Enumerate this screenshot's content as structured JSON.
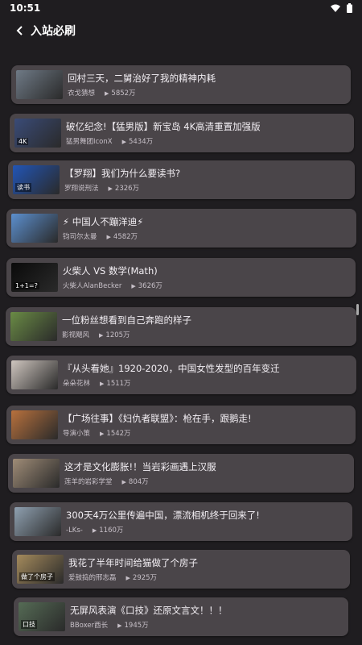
{
  "status": {
    "time": "10:51"
  },
  "header": {
    "title": "入站必刷"
  },
  "videos": [
    {
      "title": "回村三天，二舅治好了我的精神内耗",
      "author": "衣戈猜想",
      "views": "5852万",
      "thumb_color": "#6f7a86"
    },
    {
      "title": "破亿纪念!【猛男版】新宝岛 4K高清重置加强版",
      "author": "猛男舞团IconX",
      "views": "5434万",
      "thumb_color": "#3a4b77",
      "badge": "4K"
    },
    {
      "title": "【罗翔】我们为什么要读书?",
      "author": "罗翔说刑法",
      "views": "2326万",
      "thumb_color": "#2255b5",
      "badge": "读书"
    },
    {
      "title": "⚡ 中国人不蹦洋迪⚡",
      "author": "钧司尔太曼",
      "views": "4582万",
      "thumb_color": "#5c8fce"
    },
    {
      "title": "火柴人 VS 数学(Math)",
      "author": "火柴人AlanBecker",
      "views": "3626万",
      "thumb_color": "#0a0a0a",
      "badge": "1+1=?"
    },
    {
      "title": "一位粉丝想看到自己奔跑的样子",
      "author": "影视飓风",
      "views": "1205万",
      "thumb_color": "#6a8b45"
    },
    {
      "title": "『从头看她』1920-2020，中国女性发型的百年变迁",
      "author": "朵朵花林",
      "views": "1511万",
      "thumb_color": "#cfc6bf"
    },
    {
      "title": "【广场往事】《妇仇者联盟》：枪在手，跟鹅走!",
      "author": "导演小策",
      "views": "1542万",
      "thumb_color": "#b8713d"
    },
    {
      "title": "这才是文化膨胀!！当岩彩画遇上汉服",
      "author": "莲羊的岩彩学堂",
      "views": "804万",
      "thumb_color": "#9f8c77"
    },
    {
      "title": "300天4万公里传遍中国，漂流相机终于回来了!",
      "author": "-LKs-",
      "views": "1160万",
      "thumb_color": "#8fa0b0"
    },
    {
      "title": "我花了半年时间给猫做了个房子",
      "author": "爱鼓捣的邢志磊",
      "views": "2925万",
      "thumb_color": "#a48a5c",
      "badge": "做了个房子"
    },
    {
      "title": "无屏风表演《口技》还原文言文！！！",
      "author": "BBoxer酉长",
      "views": "1945万",
      "thumb_color": "#556b55",
      "badge": "口技"
    }
  ]
}
